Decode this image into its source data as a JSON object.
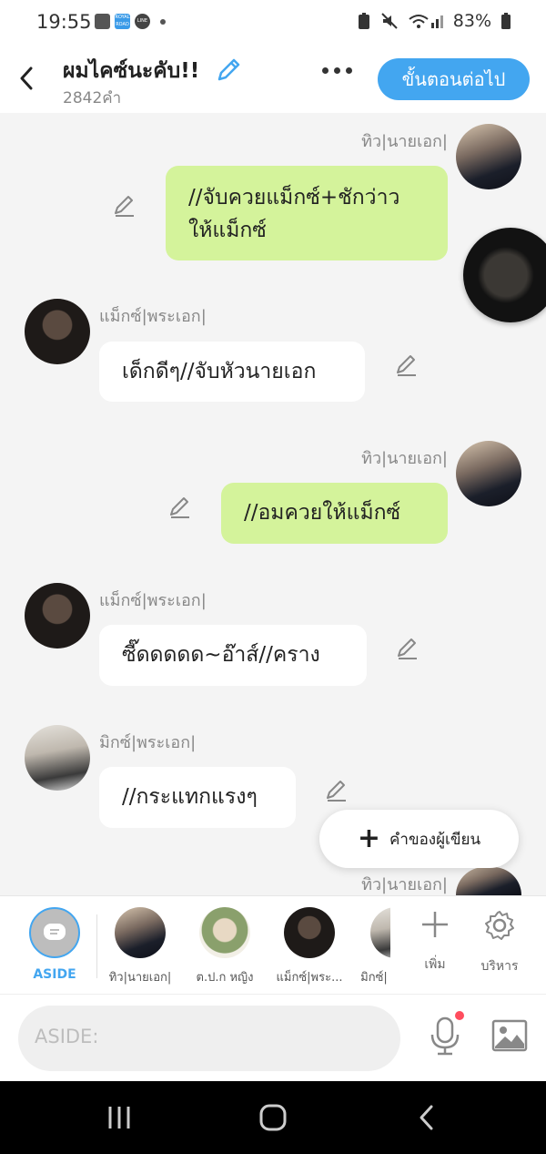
{
  "status_bar": {
    "time": "19:55",
    "battery": "83%",
    "app_icon_text": "ROYAL ROAD",
    "line_icon_text": "LINE"
  },
  "header": {
    "title": "ผมไคซ์นะคับ!!",
    "word_count": "2842คำ",
    "next_button": "ขั้นตอนต่อไป"
  },
  "messages": [
    {
      "speaker": "ทิว|นายเอก|",
      "text": "//จับควยแม็กซ์+ชักว่าวให้แม็กซ์",
      "line1": "//จับควยแม็กซ์+ชักว่าว",
      "line2": "ให้แม็กซ์",
      "side": "right"
    },
    {
      "speaker": "แม็กซ์|พระเอก|",
      "text": "เด็กดีๆ//จับหัวนายเอก",
      "side": "left"
    },
    {
      "speaker": "ทิว|นายเอก|",
      "text": "//อมควยให้แม็กซ์",
      "side": "right"
    },
    {
      "speaker": "แม็กซ์|พระเอก|",
      "text": "ซี๊ดดดดด~อ๊าส์//คราง",
      "side": "left"
    },
    {
      "speaker": "มิกซ์|พระเอก|",
      "text": "//กระแทกแรงๆ",
      "side": "left"
    },
    {
      "speaker": "ทิว|นายเอก|",
      "side": "right"
    }
  ],
  "floating_button": {
    "label": "คำของผู้เขียน"
  },
  "cast_bar": {
    "aside_label": "ASIDE",
    "characters": [
      "ทิว|นายเอก|",
      "ต.ป.ก หญิง",
      "แม็กซ์|พระ...",
      "มิกซ์|"
    ],
    "add_label": "เพิ่ม",
    "manage_label": "บริหาร"
  },
  "input": {
    "placeholder": "ASIDE:"
  },
  "colors": {
    "accent": "#43a6f0",
    "bubble_green": "#d4f39b",
    "notification_dot": "#ff4d5e"
  }
}
